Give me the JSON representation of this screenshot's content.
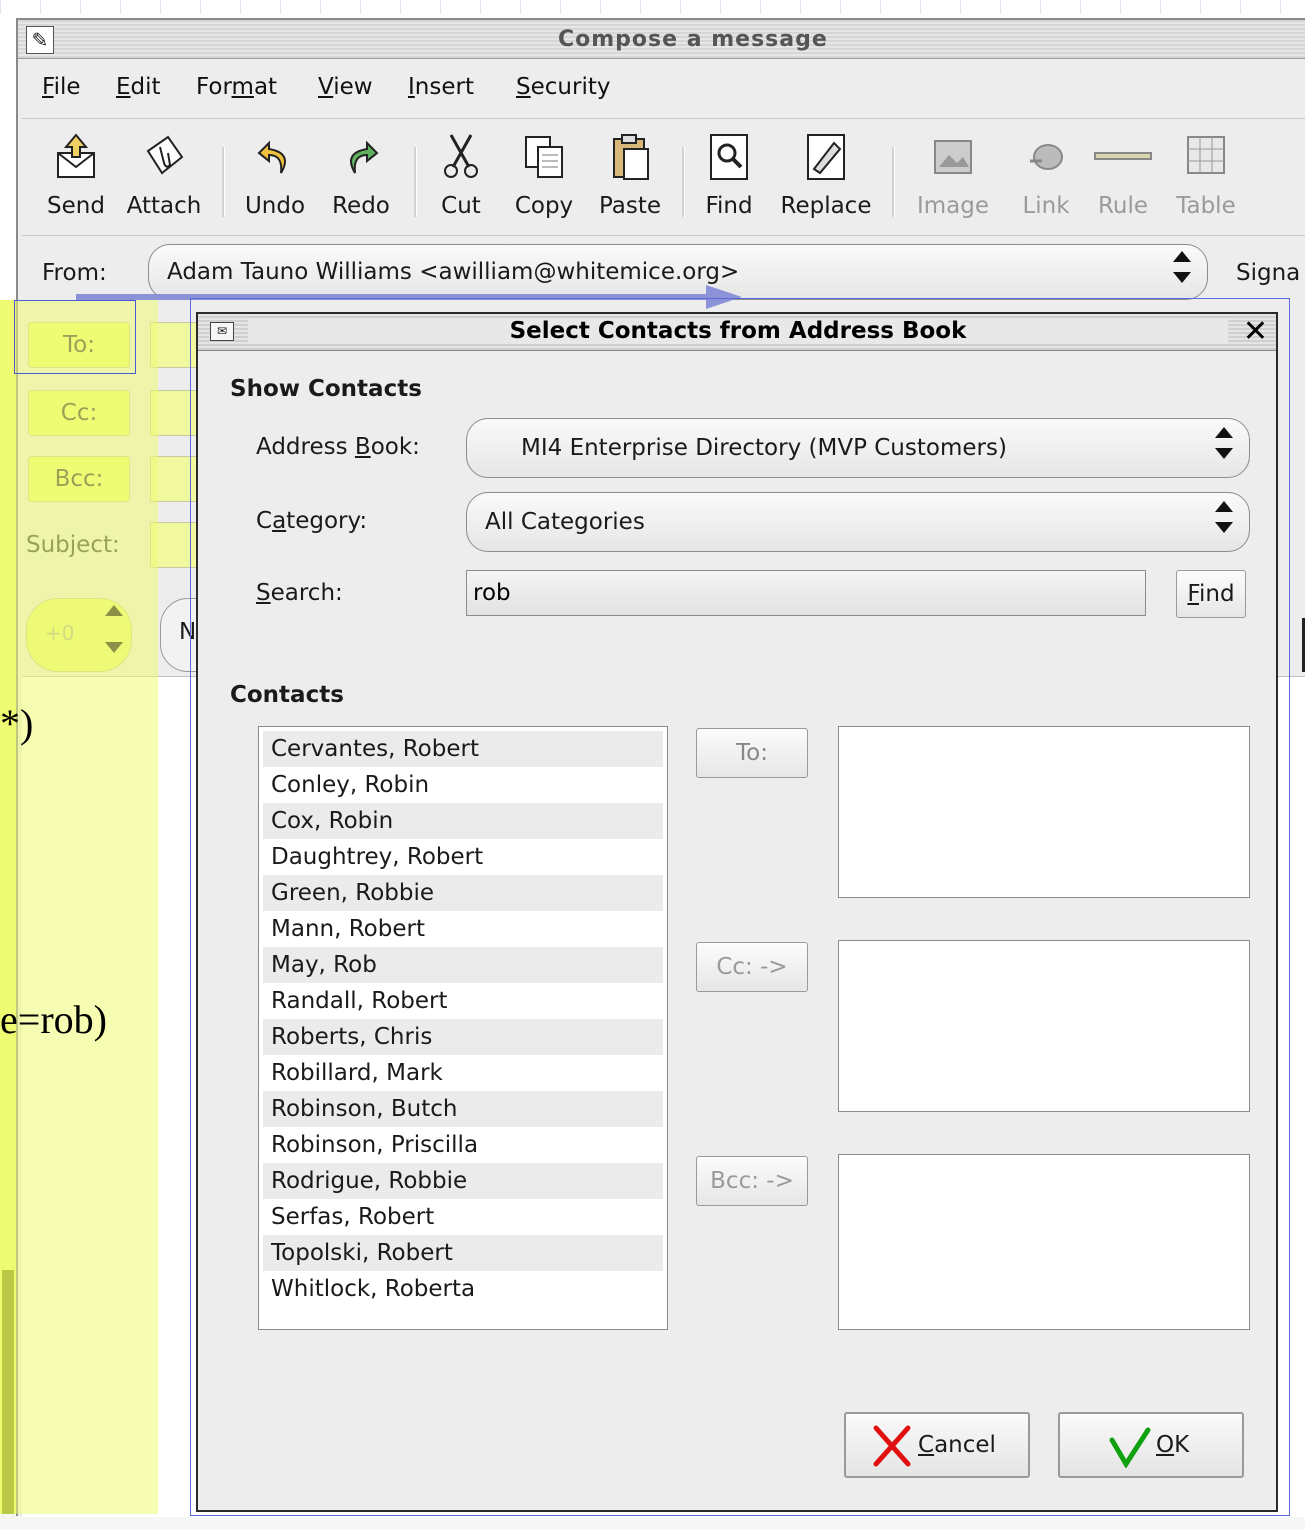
{
  "slide": {
    "big_letter": "n",
    "fragment_1": "*)",
    "fragment_2": "e=rob)"
  },
  "window": {
    "title": "Compose a message"
  },
  "menu": {
    "items": [
      {
        "label": "File",
        "mnemonic": "F"
      },
      {
        "label": "Edit",
        "mnemonic": "E"
      },
      {
        "label": "Format",
        "mnemonic": "m"
      },
      {
        "label": "View",
        "mnemonic": "V"
      },
      {
        "label": "Insert",
        "mnemonic": "I"
      },
      {
        "label": "Security",
        "mnemonic": "S"
      }
    ]
  },
  "toolbar": {
    "send": "Send",
    "attach": "Attach",
    "undo": "Undo",
    "redo": "Redo",
    "cut": "Cut",
    "copy": "Copy",
    "paste": "Paste",
    "find": "Find",
    "replace": "Replace",
    "image": "Image",
    "link": "Link",
    "rule": "Rule",
    "table": "Table"
  },
  "header": {
    "from_label": "From:",
    "from_value": "Adam Tauno Williams <awilliam@whitemice.org>",
    "signature_label": "Signa",
    "to_label": "To:",
    "cc_label": "Cc:",
    "bcc_label": "Bcc:",
    "subject_label": "Subject:",
    "priority_value": "+0",
    "tab_partial": "N"
  },
  "dialog": {
    "title": "Select Contacts from Address Book",
    "close": "✕",
    "show_contacts_heading": "Show Contacts",
    "address_book_label": "Address Book:",
    "address_book_value": "MI4 Enterprise Directory (MVP Customers)",
    "category_label": "Category:",
    "category_value": "All Categories",
    "search_label": "Search:",
    "search_value": "rob",
    "find_button": "Find",
    "contacts_heading": "Contacts",
    "contacts": [
      "Cervantes, Robert",
      "Conley, Robin",
      "Cox, Robin",
      "Daughtrey, Robert",
      "Green, Robbie",
      "Mann, Robert",
      "May, Rob",
      "Randall, Robert",
      "Roberts, Chris",
      "Robillard, Mark",
      "Robinson, Butch",
      "Robinson, Priscilla",
      "Rodrigue, Robbie",
      "Serfas, Robert",
      "Topolski, Robert",
      "Whitlock, Roberta"
    ],
    "to_button": "To:",
    "cc_button": "Cc: ->",
    "bcc_button": "Bcc: ->",
    "cancel_button": "Cancel",
    "ok_button": "OK"
  },
  "colors": {
    "highlight": "#eefc74",
    "cancel_icon": "#e01010",
    "ok_icon": "#10a010",
    "arrow": "#8c92d8"
  }
}
